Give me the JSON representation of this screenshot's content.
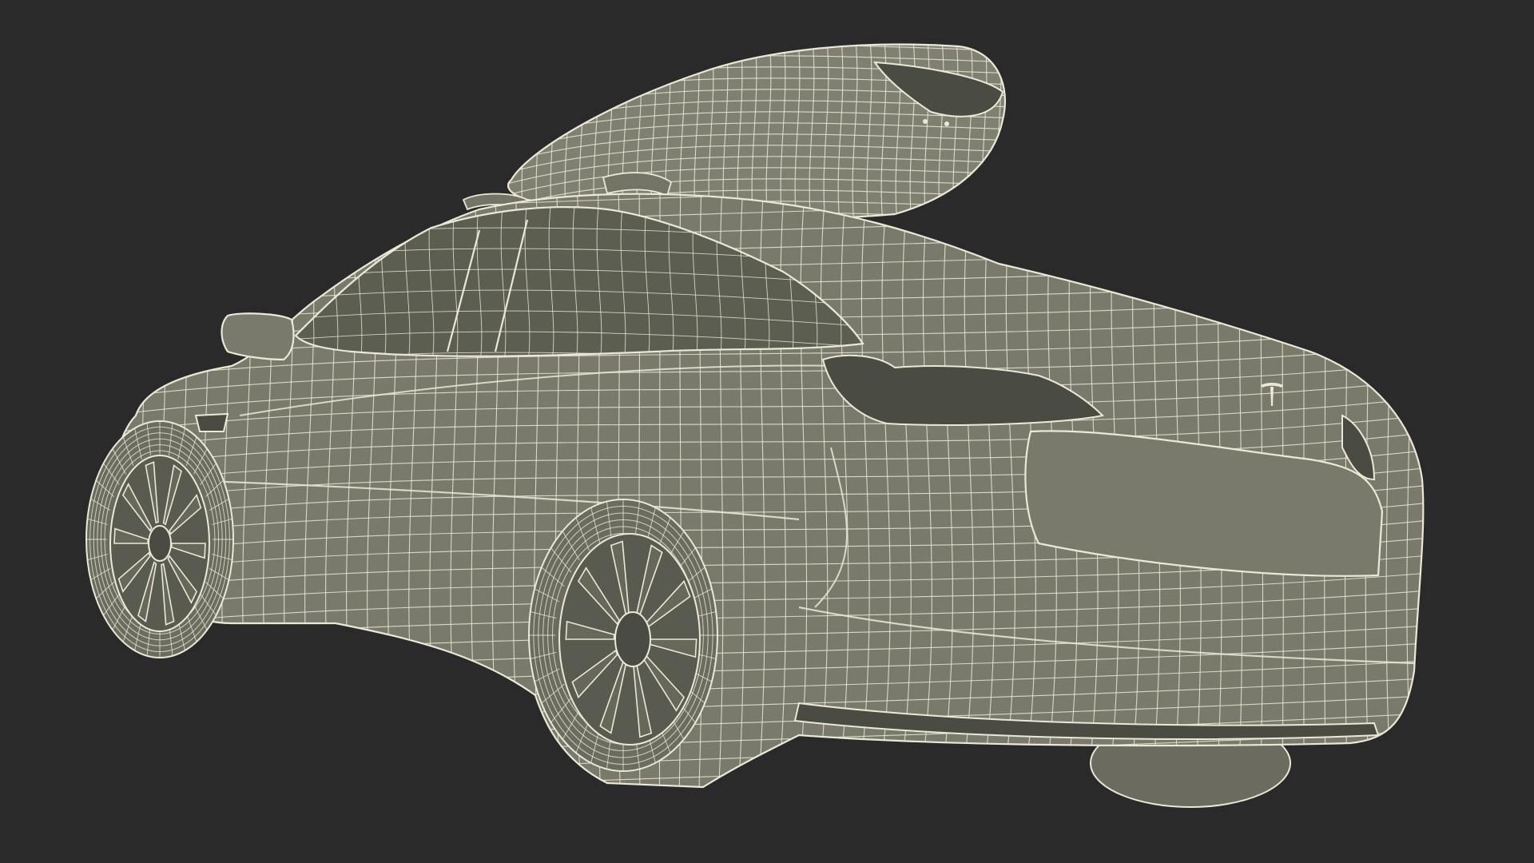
{
  "colors": {
    "background": "#2a2a2a",
    "wire": "#ebe8d6",
    "surface": "#7a7a6c"
  },
  "icons": {
    "badge": "tesla-logo-icon"
  }
}
